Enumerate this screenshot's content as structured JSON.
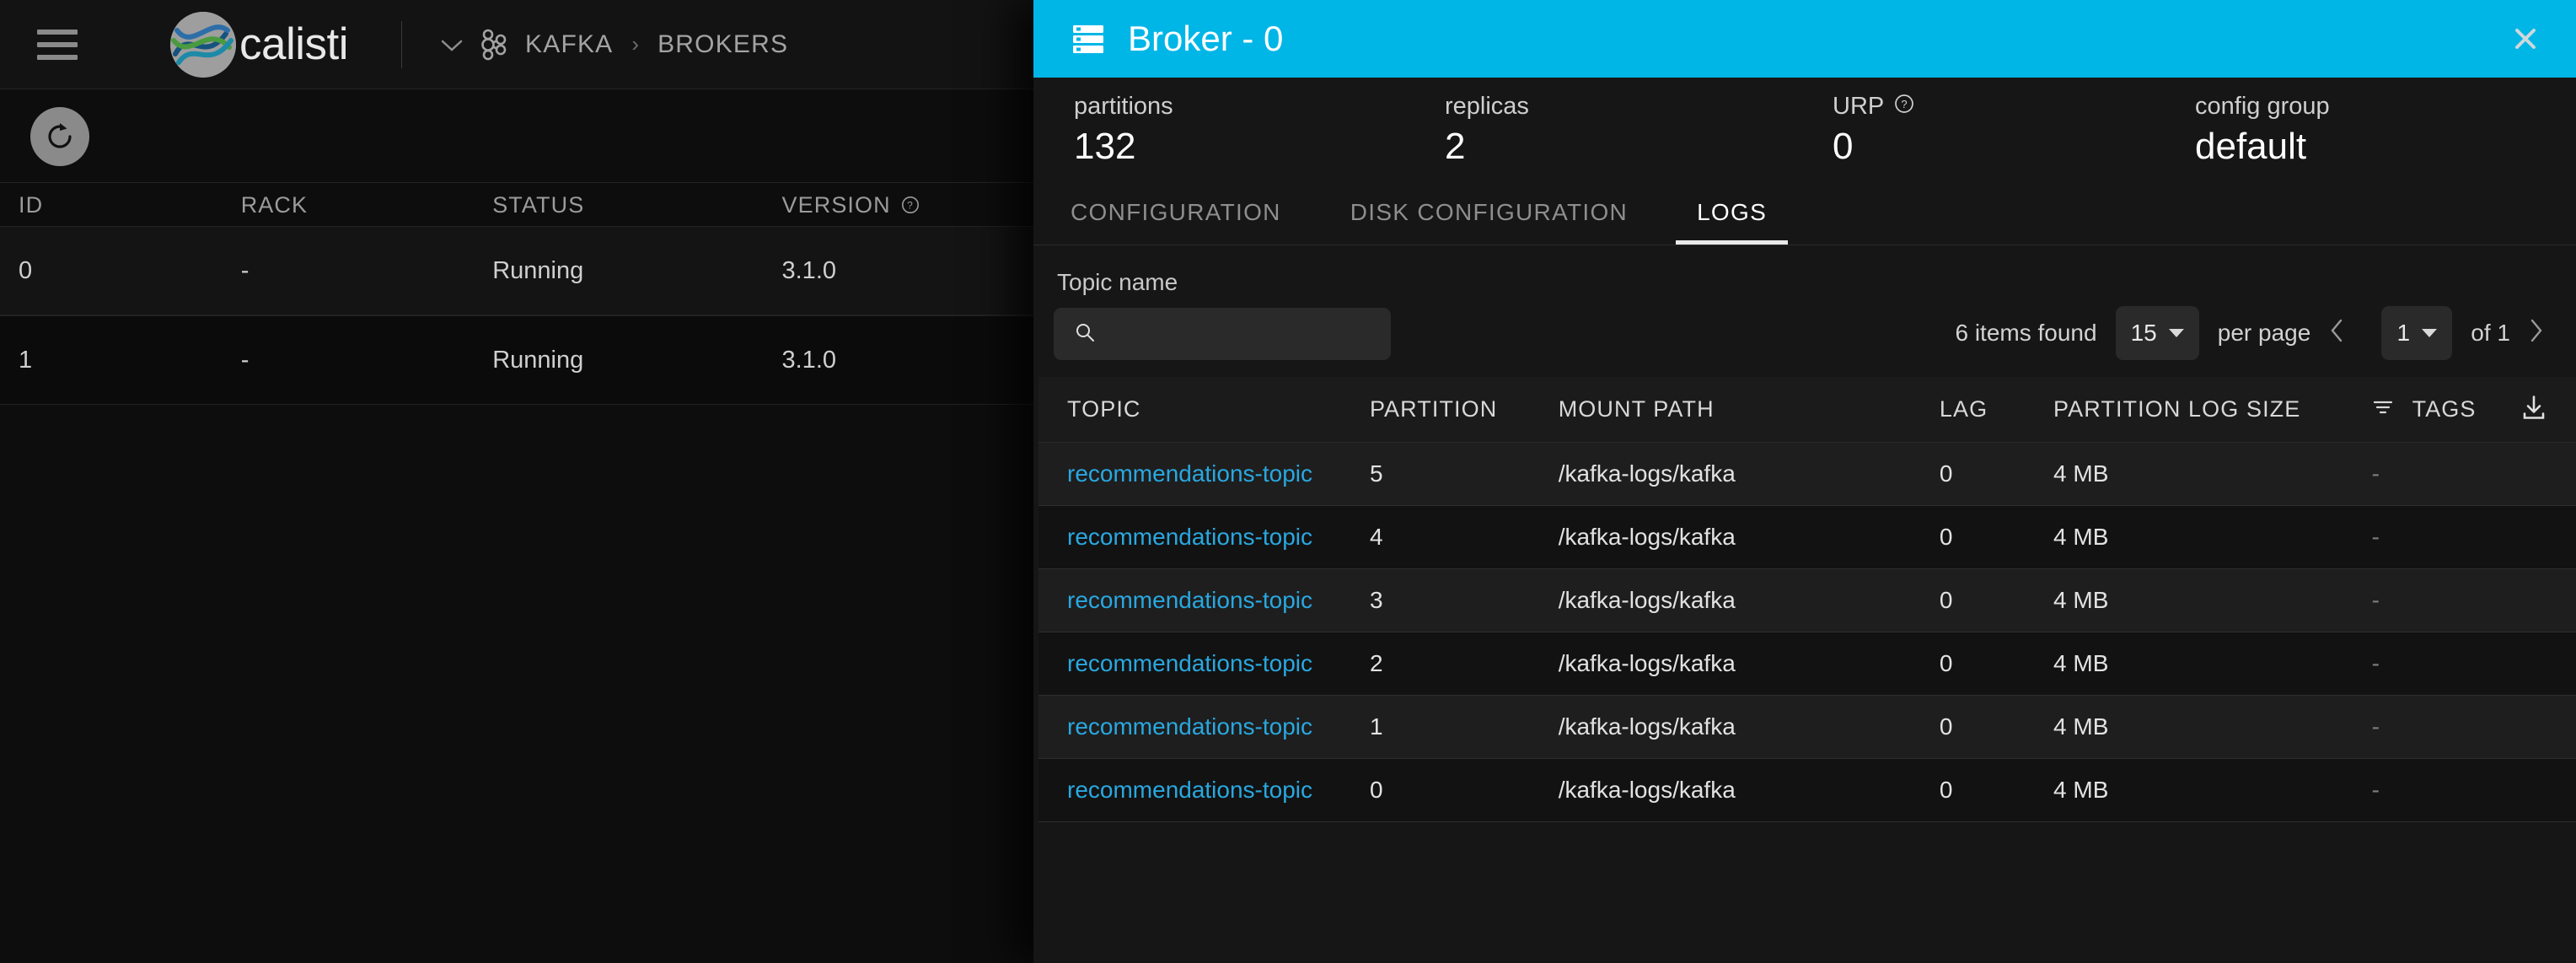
{
  "app": {
    "brand": "calisti",
    "menu_icon": "hamburger-icon",
    "breadcrumb": {
      "chevron": "chevron-down-icon",
      "cluster_icon": "kafka-icon",
      "items": [
        "KAFKA",
        "BROKERS"
      ],
      "separator": "›"
    },
    "refresh_icon": "refresh-icon"
  },
  "background_table": {
    "columns": [
      "ID",
      "RACK",
      "STATUS",
      "VERSION"
    ],
    "version_help_icon": "help-circle-icon",
    "rows": [
      {
        "id": "0",
        "rack": "-",
        "status": "Running",
        "version": "3.1.0"
      },
      {
        "id": "1",
        "rack": "-",
        "status": "Running",
        "version": "3.1.0"
      }
    ],
    "status_color": "#3f8f2e"
  },
  "panel": {
    "header": {
      "icon": "server-icon",
      "title": "Broker - 0",
      "close_icon": "close-icon",
      "bg_color": "#00b6e6"
    },
    "stats": [
      {
        "label": "partitions",
        "value": "132"
      },
      {
        "label": "replicas",
        "value": "2"
      },
      {
        "label": "URP",
        "value": "0",
        "help_icon": "help-circle-icon"
      },
      {
        "label": "config group",
        "value": "default"
      }
    ],
    "tabs": [
      {
        "label": "CONFIGURATION",
        "active": false
      },
      {
        "label": "DISK CONFIGURATION",
        "active": false
      },
      {
        "label": "LOGS",
        "active": true
      }
    ],
    "filter": {
      "label": "Topic name",
      "search_icon": "search-icon",
      "value": "",
      "placeholder": ""
    },
    "pagination": {
      "items_found": "6 items found",
      "per_page_value": "15",
      "per_page_label": "per page",
      "prev_icon": "chevron-left-icon",
      "page_value": "1",
      "of_label": "of 1",
      "next_icon": "chevron-right-icon"
    },
    "table": {
      "columns": [
        "TOPIC",
        "PARTITION",
        "MOUNT PATH",
        "LAG",
        "PARTITION LOG SIZE",
        "TAGS"
      ],
      "tags_filter_icon": "filter-icon",
      "download_icon": "download-icon",
      "link_color": "#29a8e0",
      "rows": [
        {
          "topic": "recommendations-topic",
          "partition": "5",
          "mount_path": "/kafka-logs/kafka",
          "lag": "0",
          "log_size": "4 MB",
          "tags": "-"
        },
        {
          "topic": "recommendations-topic",
          "partition": "4",
          "mount_path": "/kafka-logs/kafka",
          "lag": "0",
          "log_size": "4 MB",
          "tags": "-"
        },
        {
          "topic": "recommendations-topic",
          "partition": "3",
          "mount_path": "/kafka-logs/kafka",
          "lag": "0",
          "log_size": "4 MB",
          "tags": "-"
        },
        {
          "topic": "recommendations-topic",
          "partition": "2",
          "mount_path": "/kafka-logs/kafka",
          "lag": "0",
          "log_size": "4 MB",
          "tags": "-"
        },
        {
          "topic": "recommendations-topic",
          "partition": "1",
          "mount_path": "/kafka-logs/kafka",
          "lag": "0",
          "log_size": "4 MB",
          "tags": "-"
        },
        {
          "topic": "recommendations-topic",
          "partition": "0",
          "mount_path": "/kafka-logs/kafka",
          "lag": "0",
          "log_size": "4 MB",
          "tags": "-"
        }
      ]
    }
  }
}
